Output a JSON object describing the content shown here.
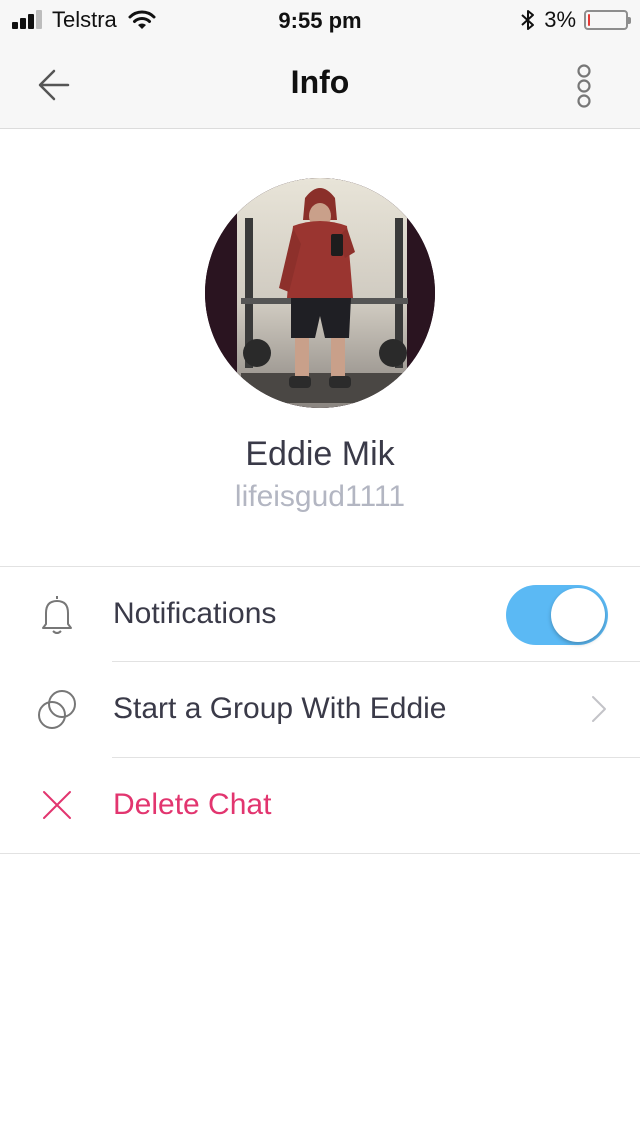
{
  "status_bar": {
    "carrier": "Telstra",
    "time": "9:55 pm",
    "battery_percent": "3%",
    "battery_level": 0.03,
    "signal_bars_filled": 3,
    "signal_bars_total": 4,
    "icons": [
      "signal-icon",
      "wifi-icon",
      "bluetooth-icon",
      "battery-icon"
    ]
  },
  "nav": {
    "title": "Info",
    "back_icon": "back-arrow-icon",
    "more_icon": "more-vertical-icon"
  },
  "profile": {
    "name": "Eddie Mik",
    "username": "lifeisgud1111"
  },
  "settings": {
    "notifications": {
      "label": "Notifications",
      "icon": "bell-icon",
      "enabled": true
    },
    "start_group": {
      "label": "Start a Group With Eddie",
      "icon": "group-circles-icon"
    },
    "delete_chat": {
      "label": "Delete Chat",
      "icon": "close-icon"
    }
  },
  "colors": {
    "accent": "#5bb9f4",
    "danger": "#e2356f",
    "battery_low": "#e53935",
    "muted_text": "#b3b6c2"
  }
}
